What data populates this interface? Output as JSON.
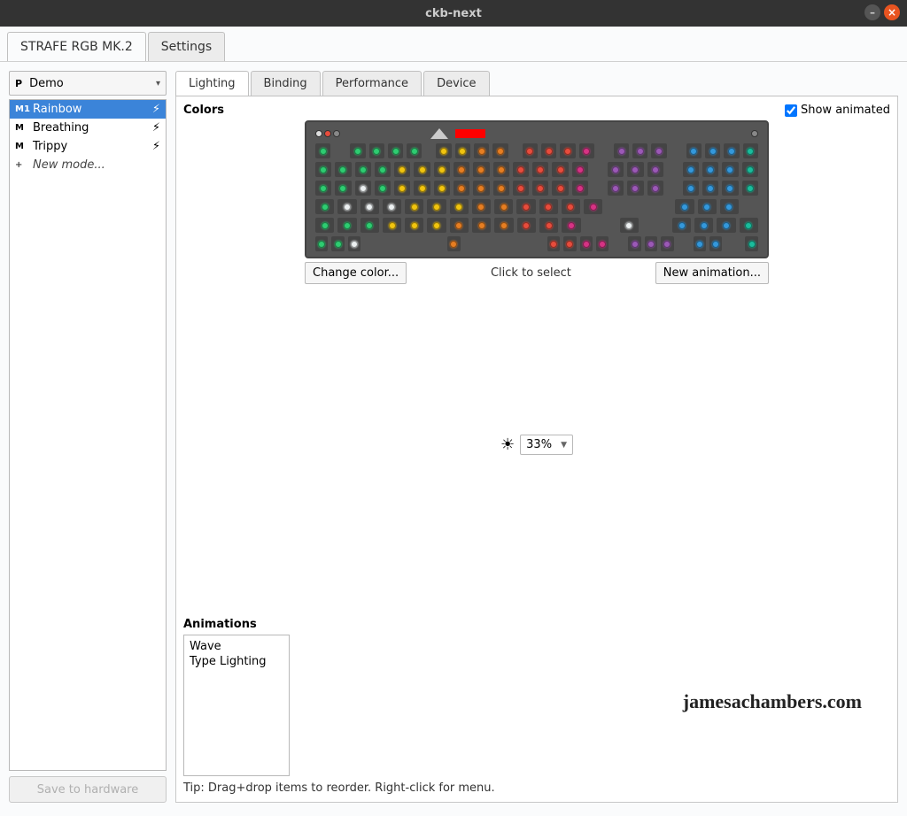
{
  "window": {
    "title": "ckb-next"
  },
  "top_tabs": [
    {
      "label": "STRAFE RGB MK.2",
      "active": true
    },
    {
      "label": "Settings",
      "active": false
    }
  ],
  "profile": {
    "badge": "P",
    "selected": "Demo"
  },
  "modes": [
    {
      "badge": "M1",
      "name": "Rainbow",
      "bolt": true,
      "selected": true
    },
    {
      "badge": "M",
      "name": "Breathing",
      "bolt": true
    },
    {
      "badge": "M",
      "name": "Trippy",
      "bolt": true
    },
    {
      "badge": "+",
      "name": "New mode...",
      "new": true
    }
  ],
  "save_button": "Save to hardware",
  "sub_tabs": [
    {
      "label": "Lighting",
      "active": true
    },
    {
      "label": "Binding"
    },
    {
      "label": "Performance"
    },
    {
      "label": "Device"
    }
  ],
  "colors": {
    "title": "Colors",
    "show_animated_label": "Show animated",
    "show_animated_checked": true,
    "change_color_btn": "Change color...",
    "hint": "Click to select",
    "new_anim_btn": "New animation..."
  },
  "brightness": {
    "value": "33%"
  },
  "animations": {
    "title": "Animations",
    "items": [
      "Wave",
      "Type Lighting"
    ],
    "tip": "Tip: Drag+drop items to reorder. Right-click for menu."
  },
  "watermark": "jamesachambers.com",
  "key_colors": {
    "green": "#2ecc71",
    "yellow": "#f1c40f",
    "orange": "#e67e22",
    "red": "#e74c3c",
    "magenta": "#d63384",
    "purple": "#9b59b6",
    "blue": "#3498db",
    "cyan": "#1abc9c",
    "white": "#ecf0f1"
  }
}
